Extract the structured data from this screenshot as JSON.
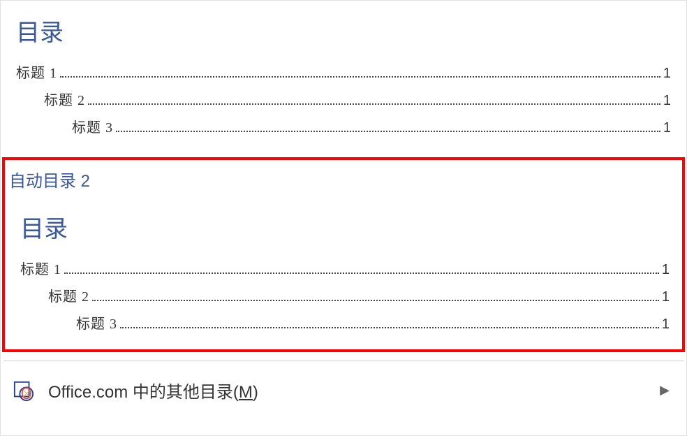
{
  "block1": {
    "title": "目录",
    "entries": [
      {
        "label": "标题 1",
        "page": "1"
      },
      {
        "label": "标题 2",
        "page": "1"
      },
      {
        "label": "标题 3",
        "page": "1"
      }
    ]
  },
  "block2": {
    "header": "自动目录 2",
    "title": "目录",
    "entries": [
      {
        "label": "标题 1",
        "page": "1"
      },
      {
        "label": "标题 2",
        "page": "1"
      },
      {
        "label": "标题 3",
        "page": "1"
      }
    ]
  },
  "footer": {
    "text_prefix": "Office.com 中的其他目录(",
    "mnemonic": "M",
    "text_suffix": ")"
  }
}
